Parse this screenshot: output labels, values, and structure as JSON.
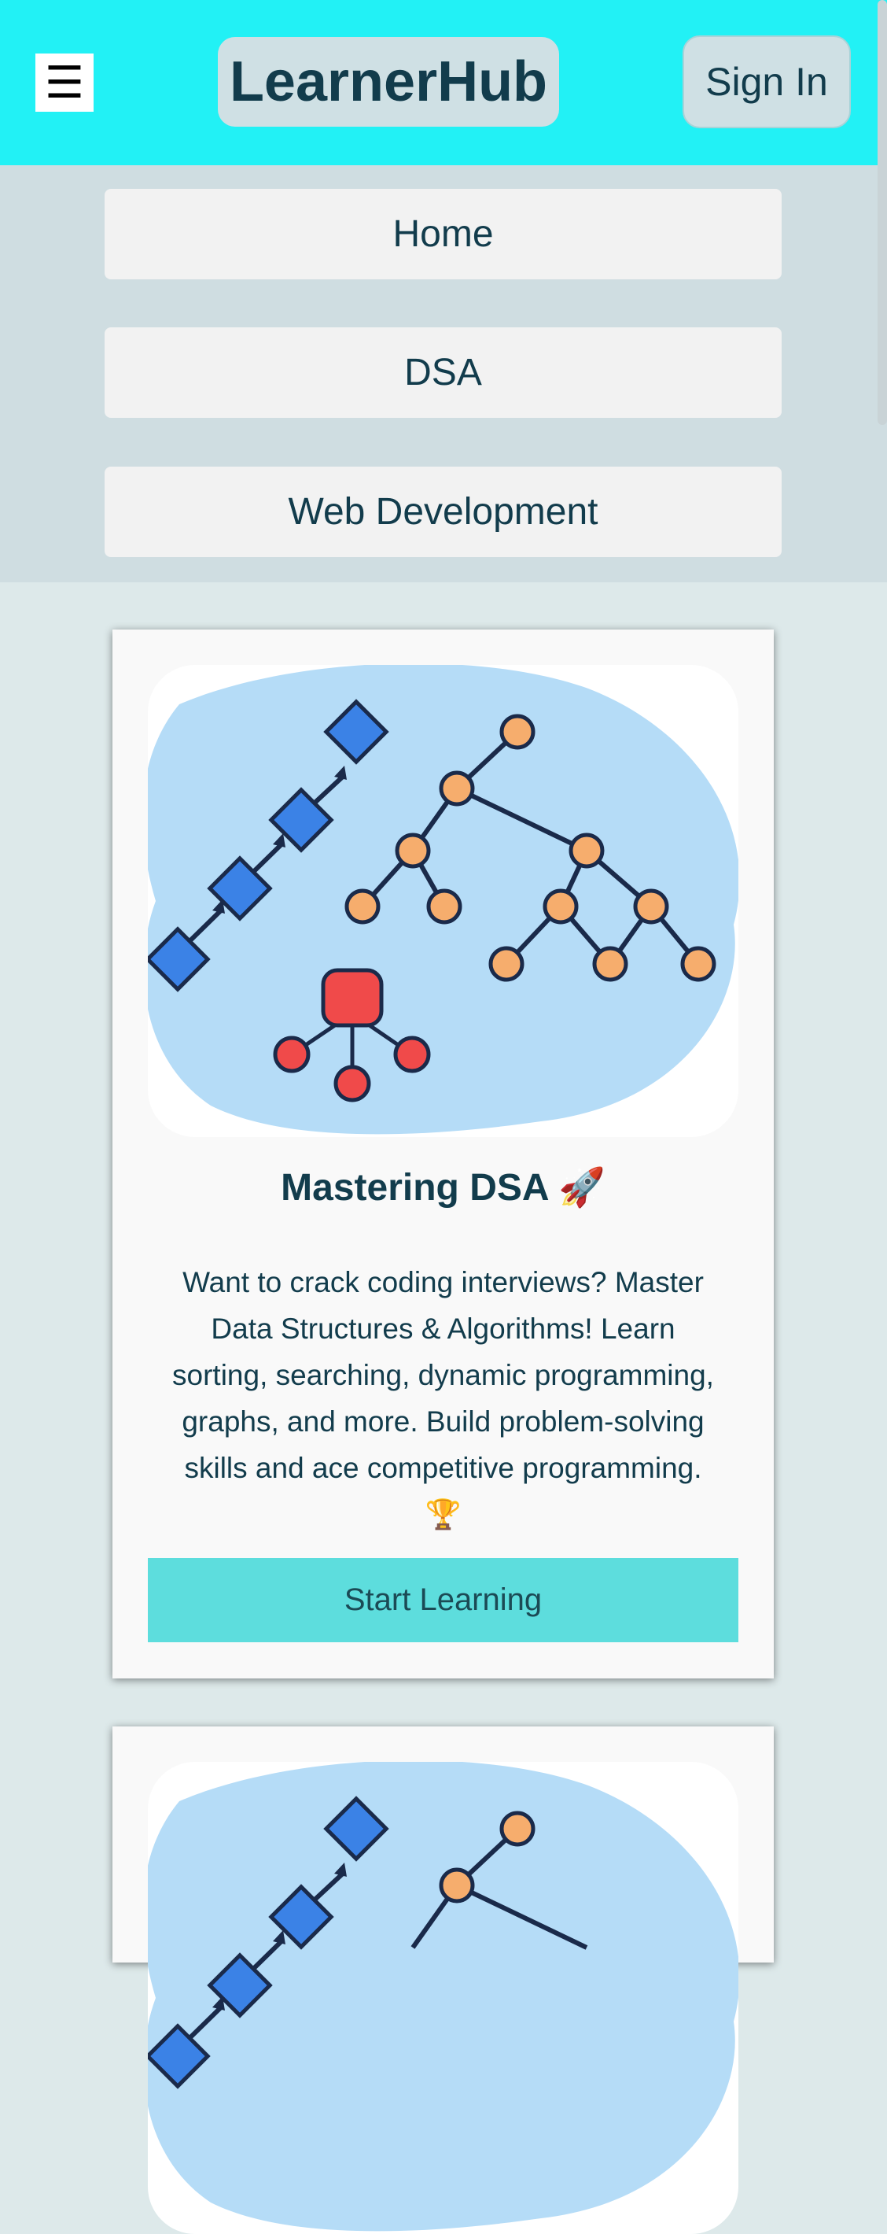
{
  "header": {
    "menu_icon": "hamburger-icon",
    "menu_glyph": "☰",
    "logo": "LearnerHub",
    "sign_in": "Sign In"
  },
  "nav": {
    "items": [
      {
        "label": "Home"
      },
      {
        "label": "DSA"
      },
      {
        "label": "Web Development"
      }
    ]
  },
  "cards": [
    {
      "title": "Mastering DSA 🚀",
      "description": "Want to crack coding interviews? Master Data Structures & Algorithms! Learn sorting, searching, dynamic programming, graphs, and more. Build problem-solving skills and ace competitive programming. 🏆",
      "button": "Start Learning",
      "image": "data-structures-illustration"
    },
    {
      "image": "data-structures-illustration"
    }
  ],
  "colors": {
    "header_bg": "#22f1f5",
    "nav_bg": "#cfdde1",
    "page_bg": "#dde9ea",
    "button_bg": "#5ddddd",
    "text": "#123c4c"
  }
}
